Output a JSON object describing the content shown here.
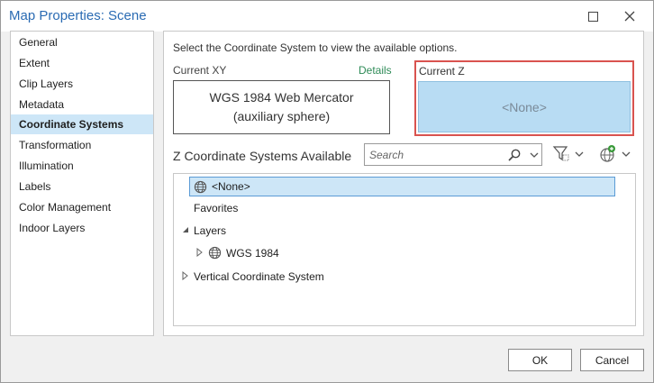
{
  "window": {
    "title": "Map Properties: Scene",
    "maximize_icon": "maximize-icon",
    "close_icon": "close-icon"
  },
  "nav": {
    "items": [
      {
        "label": "General"
      },
      {
        "label": "Extent"
      },
      {
        "label": "Clip Layers"
      },
      {
        "label": "Metadata"
      },
      {
        "label": "Coordinate Systems",
        "selected": true
      },
      {
        "label": "Transformation"
      },
      {
        "label": "Illumination"
      },
      {
        "label": "Labels"
      },
      {
        "label": "Color Management"
      },
      {
        "label": "Indoor Layers"
      }
    ]
  },
  "panel": {
    "intro": "Select the Coordinate System to view the available options.",
    "current_xy_label": "Current XY",
    "details_link": "Details",
    "current_xy_line1": "WGS 1984 Web Mercator",
    "current_xy_line2": "(auxiliary sphere)",
    "current_z_label": "Current Z",
    "current_z_value": "<None>",
    "z_heading": "Z Coordinate Systems Available",
    "search": {
      "placeholder": "Search",
      "value": ""
    },
    "tree": [
      {
        "label": "<None>",
        "selected": true,
        "icon": "globe-icon"
      },
      {
        "label": "Favorites"
      },
      {
        "label": "Layers",
        "expanded": true
      },
      {
        "label": "WGS 1984",
        "icon": "globe-icon"
      },
      {
        "label": "Vertical Coordinate System"
      }
    ]
  },
  "buttons": {
    "ok": "OK",
    "cancel": "Cancel"
  },
  "colors": {
    "title": "#2a6bb3",
    "selection": "#cde6f7",
    "current_z_fill": "#b8dcf3",
    "highlight_frame": "#d9534f",
    "details_link": "#2e8b57"
  }
}
